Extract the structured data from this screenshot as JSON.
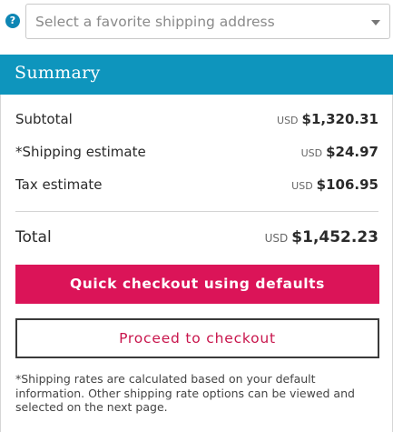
{
  "address_selector": {
    "help_icon_glyph": "?",
    "placeholder": "Select a favorite shipping address"
  },
  "summary": {
    "title": "Summary",
    "lines": [
      {
        "label": "Subtotal",
        "currency": "USD",
        "value": "$1,320.31"
      },
      {
        "label": "*Shipping estimate",
        "currency": "USD",
        "value": "$24.97"
      },
      {
        "label": "Tax estimate",
        "currency": "USD",
        "value": "$106.95"
      }
    ],
    "total": {
      "label": "Total",
      "currency": "USD",
      "value": "$1,452.23"
    },
    "quick_checkout_label": "Quick checkout using defaults",
    "proceed_label": "Proceed to checkout",
    "note": "*Shipping rates are calculated based on your default information. Other shipping rate options can be viewed and selected on the next page."
  },
  "colors": {
    "header_blue": "#0e95bd",
    "help_blue": "#0e86b4",
    "primary_button": "#db1458",
    "secondary_text": "#c8154c"
  }
}
